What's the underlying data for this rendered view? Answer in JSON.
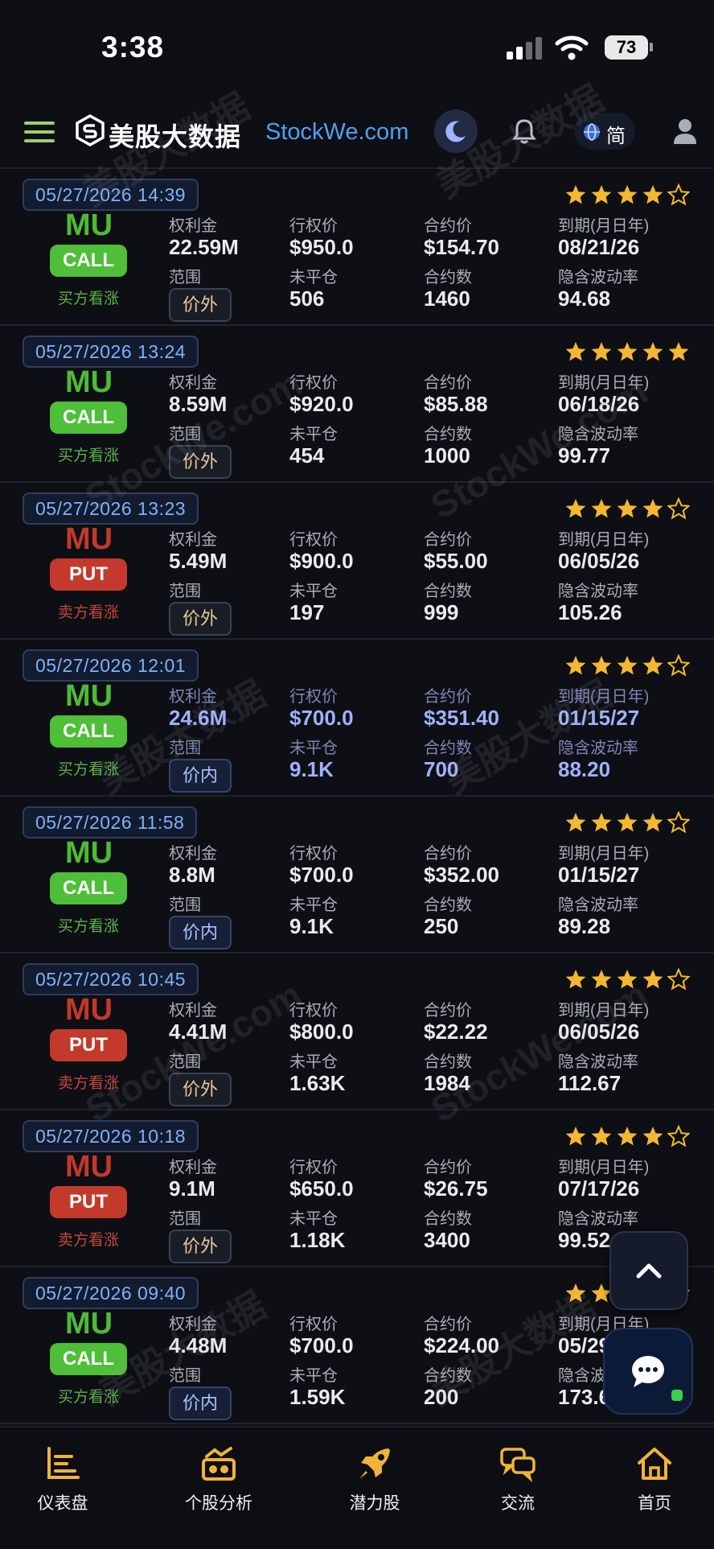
{
  "status_bar": {
    "time": "3:38",
    "battery": "73"
  },
  "header": {
    "brand_cn": "美股大数据",
    "brand_en": "StockWe.com",
    "lang": "简"
  },
  "labels": {
    "premium": "权利金",
    "strike": "行权价",
    "contract_price": "合约价",
    "expiry": "到期(月日年)",
    "range": "范围",
    "open_interest": "未平仓",
    "contracts": "合约数",
    "iv": "隐含波动率"
  },
  "watermark": {
    "cn": "美股大数据",
    "en": "StockWe.com"
  },
  "trades": [
    {
      "time": "05/27/2026 14:39",
      "rating": 4,
      "ticker": "MU",
      "type": "CALL",
      "side": "买方看涨",
      "premium": "22.59M",
      "strike": "$950.0",
      "price": "$154.70",
      "expiry": "08/21/26",
      "range": "价外",
      "oi": "506",
      "contracts": "1460",
      "iv": "94.68"
    },
    {
      "time": "05/27/2026 13:24",
      "rating": 5,
      "ticker": "MU",
      "type": "CALL",
      "side": "买方看涨",
      "premium": "8.59M",
      "strike": "$920.0",
      "price": "$85.88",
      "expiry": "06/18/26",
      "range": "价外",
      "oi": "454",
      "contracts": "1000",
      "iv": "99.77"
    },
    {
      "time": "05/27/2026 13:23",
      "rating": 4,
      "ticker": "MU",
      "type": "PUT",
      "side": "卖方看涨",
      "premium": "5.49M",
      "strike": "$900.0",
      "price": "$55.00",
      "expiry": "06/05/26",
      "range": "价外",
      "oi": "197",
      "contracts": "999",
      "iv": "105.26"
    },
    {
      "time": "05/27/2026 12:01",
      "rating": 4,
      "ticker": "MU",
      "type": "CALL",
      "side": "买方看涨",
      "premium": "24.6M",
      "strike": "$700.0",
      "price": "$351.40",
      "expiry": "01/15/27",
      "range": "价内",
      "oi": "9.1K",
      "contracts": "700",
      "iv": "88.20"
    },
    {
      "time": "05/27/2026 11:58",
      "rating": 4,
      "ticker": "MU",
      "type": "CALL",
      "side": "买方看涨",
      "premium": "8.8M",
      "strike": "$700.0",
      "price": "$352.00",
      "expiry": "01/15/27",
      "range": "价内",
      "oi": "9.1K",
      "contracts": "250",
      "iv": "89.28"
    },
    {
      "time": "05/27/2026 10:45",
      "rating": 4,
      "ticker": "MU",
      "type": "PUT",
      "side": "卖方看涨",
      "premium": "4.41M",
      "strike": "$800.0",
      "price": "$22.22",
      "expiry": "06/05/26",
      "range": "价外",
      "oi": "1.63K",
      "contracts": "1984",
      "iv": "112.67"
    },
    {
      "time": "05/27/2026 10:18",
      "rating": 4,
      "ticker": "MU",
      "type": "PUT",
      "side": "卖方看涨",
      "premium": "9.1M",
      "strike": "$650.0",
      "price": "$26.75",
      "expiry": "07/17/26",
      "range": "价外",
      "oi": "1.18K",
      "contracts": "3400",
      "iv": "99.52"
    },
    {
      "time": "05/27/2026 09:40",
      "rating": 2,
      "ticker": "MU",
      "type": "CALL",
      "side": "买方看涨",
      "premium": "4.48M",
      "strike": "$700.0",
      "price": "$224.00",
      "expiry": "05/29",
      "range": "价内",
      "oi": "1.59K",
      "contracts": "200",
      "iv": "173.6"
    }
  ],
  "tabbar": {
    "dashboard": "仪表盘",
    "stock_analysis": "个股分析",
    "potential": "潜力股",
    "community": "交流",
    "home": "首页"
  },
  "colors": {
    "call": "#4fbe38",
    "put": "#c33a2c",
    "star": "#f4b731",
    "accent": "#4ea0f3"
  }
}
